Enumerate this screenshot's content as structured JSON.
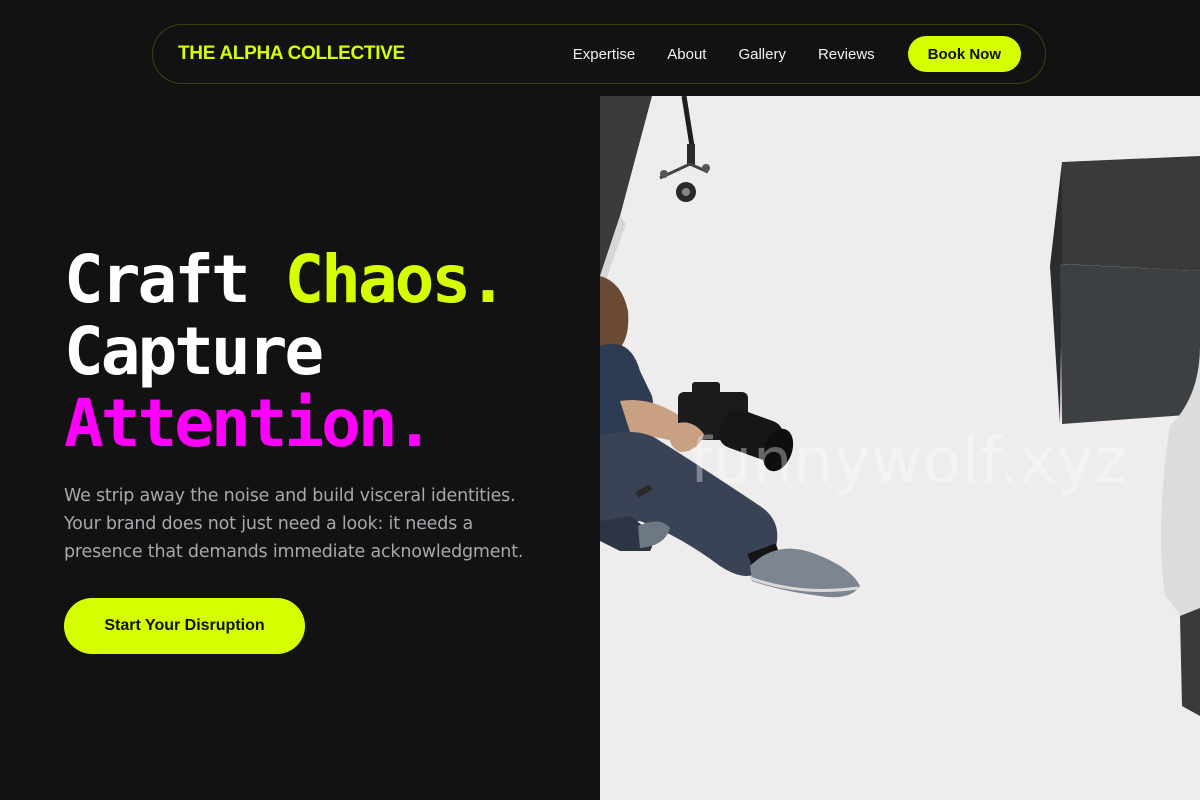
{
  "nav": {
    "brand": "THE ALPHA COLLECTIVE",
    "links": [
      "Expertise",
      "About",
      "Gallery",
      "Reviews"
    ],
    "book_label": "Book Now"
  },
  "hero": {
    "title_line1_word1": "Craft",
    "title_line1_word2": "Chaos.",
    "title_line2": "Capture",
    "title_line3": "Attention.",
    "subtitle": "We strip away the noise and build visceral identities. Your brand does not just need a look: it needs a presence that demands immediate acknowledgment.",
    "cta_label": "Start Your Disruption"
  },
  "image": {
    "subject": "photographer-in-studio-photo",
    "watermark": "funnywolf.xyz"
  },
  "colors": {
    "background": "#121212",
    "accent_lime": "#d4ff00",
    "accent_magenta": "#ff00ff",
    "text_muted": "#a6a8ad"
  }
}
